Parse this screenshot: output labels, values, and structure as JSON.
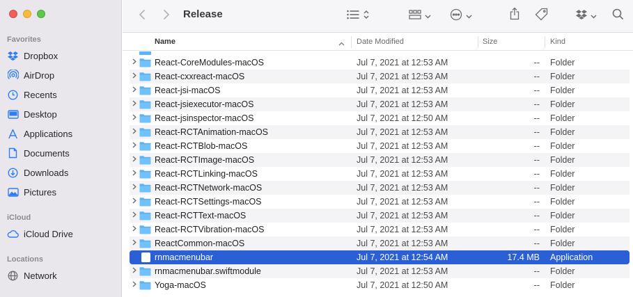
{
  "sidebar": {
    "sections": [
      {
        "title": "Favorites"
      },
      {
        "title": "iCloud"
      },
      {
        "title": "Locations"
      }
    ],
    "items": [
      {
        "label": "Dropbox",
        "icon": "dropbox-icon"
      },
      {
        "label": "AirDrop",
        "icon": "airdrop-icon"
      },
      {
        "label": "Recents",
        "icon": "clock-icon"
      },
      {
        "label": "Desktop",
        "icon": "desktop-icon"
      },
      {
        "label": "Applications",
        "icon": "applications-icon"
      },
      {
        "label": "Documents",
        "icon": "document-icon"
      },
      {
        "label": "Downloads",
        "icon": "download-icon"
      },
      {
        "label": "Pictures",
        "icon": "pictures-icon"
      },
      {
        "label": "iCloud Drive",
        "icon": "cloud-icon"
      },
      {
        "label": "Network",
        "icon": "network-icon"
      }
    ]
  },
  "toolbar": {
    "title": "Release"
  },
  "columns": {
    "name": "Name",
    "date": "Date Modified",
    "size": "Size",
    "kind": "Kind"
  },
  "rows": [
    {
      "name": "React-CoreModules-macOS",
      "date": "Jul 7, 2021 at 12:53 AM",
      "size": "--",
      "kind": "Folder"
    },
    {
      "name": "React-cxxreact-macOS",
      "date": "Jul 7, 2021 at 12:53 AM",
      "size": "--",
      "kind": "Folder"
    },
    {
      "name": "React-jsi-macOS",
      "date": "Jul 7, 2021 at 12:53 AM",
      "size": "--",
      "kind": "Folder"
    },
    {
      "name": "React-jsiexecutor-macOS",
      "date": "Jul 7, 2021 at 12:53 AM",
      "size": "--",
      "kind": "Folder"
    },
    {
      "name": "React-jsinspector-macOS",
      "date": "Jul 7, 2021 at 12:50 AM",
      "size": "--",
      "kind": "Folder"
    },
    {
      "name": "React-RCTAnimation-macOS",
      "date": "Jul 7, 2021 at 12:53 AM",
      "size": "--",
      "kind": "Folder"
    },
    {
      "name": "React-RCTBlob-macOS",
      "date": "Jul 7, 2021 at 12:53 AM",
      "size": "--",
      "kind": "Folder"
    },
    {
      "name": "React-RCTImage-macOS",
      "date": "Jul 7, 2021 at 12:53 AM",
      "size": "--",
      "kind": "Folder"
    },
    {
      "name": "React-RCTLinking-macOS",
      "date": "Jul 7, 2021 at 12:53 AM",
      "size": "--",
      "kind": "Folder"
    },
    {
      "name": "React-RCTNetwork-macOS",
      "date": "Jul 7, 2021 at 12:53 AM",
      "size": "--",
      "kind": "Folder"
    },
    {
      "name": "React-RCTSettings-macOS",
      "date": "Jul 7, 2021 at 12:53 AM",
      "size": "--",
      "kind": "Folder"
    },
    {
      "name": "React-RCTText-macOS",
      "date": "Jul 7, 2021 at 12:53 AM",
      "size": "--",
      "kind": "Folder"
    },
    {
      "name": "React-RCTVibration-macOS",
      "date": "Jul 7, 2021 at 12:53 AM",
      "size": "--",
      "kind": "Folder"
    },
    {
      "name": "ReactCommon-macOS",
      "date": "Jul 7, 2021 at 12:53 AM",
      "size": "--",
      "kind": "Folder"
    },
    {
      "name": "rnmacmenubar",
      "date": "Jul 7, 2021 at 12:54 AM",
      "size": "17.4 MB",
      "kind": "Application",
      "selected": true
    },
    {
      "name": "rnmacmenubar.swiftmodule",
      "date": "Jul 7, 2021 at 12:53 AM",
      "size": "--",
      "kind": "Folder"
    },
    {
      "name": "Yoga-macOS",
      "date": "Jul 7, 2021 at 12:50 AM",
      "size": "--",
      "kind": "Folder"
    }
  ],
  "colors": {
    "accent": "#2a5fd6",
    "folder": "#5bb4f5",
    "sidebar_icon": "#2f7df6"
  }
}
